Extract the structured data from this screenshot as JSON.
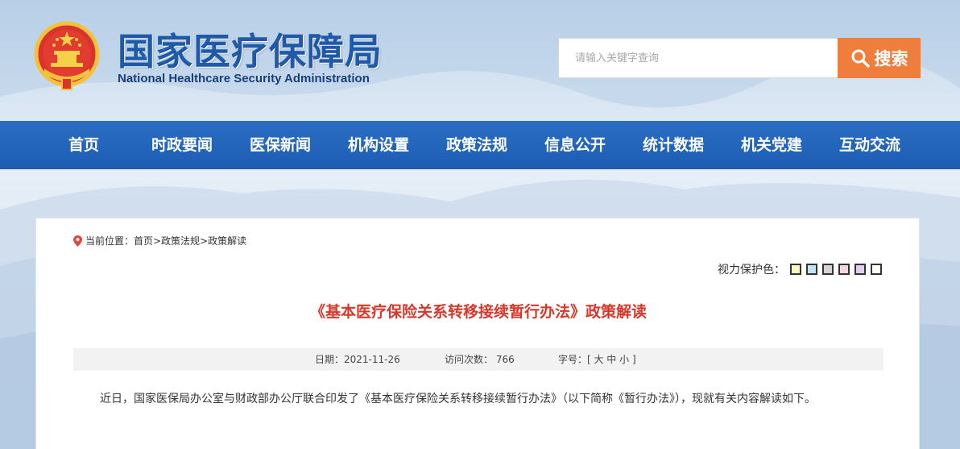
{
  "header": {
    "title": "国家医疗保障局",
    "subtitle": "National Healthcare Security Administration",
    "logo_icon": "national-emblem-icon"
  },
  "search": {
    "placeholder": "请输入关键字查询",
    "button_label": "搜索",
    "button_color": "#ef7d3c",
    "icon": "search-icon"
  },
  "nav": {
    "background": "#1d5db4",
    "items": [
      {
        "label": "首页"
      },
      {
        "label": "时政要闻"
      },
      {
        "label": "医保新闻"
      },
      {
        "label": "机构设置"
      },
      {
        "label": "政策法规"
      },
      {
        "label": "信息公开"
      },
      {
        "label": "统计数据"
      },
      {
        "label": "机关党建"
      },
      {
        "label": "互动交流"
      }
    ]
  },
  "breadcrumb": {
    "icon": "location-pin-icon",
    "text": "当前位置：首页>政策法规>政策解读"
  },
  "vision_protection": {
    "label": "视力保护色：",
    "swatches": [
      "#fafac0",
      "#bfe6f5",
      "#d5d5d5",
      "#f6d6dc",
      "#e2cdf3",
      "#ffffff"
    ]
  },
  "article": {
    "title": "《基本医疗保险关系转移接续暂行办法》政策解读",
    "title_color": "#d8382b",
    "date": "日期：2021-11-26",
    "visits": "访问次数： 766",
    "font_size": "字号：[ 大 中 小 ]",
    "body": "近日，国家医保局办公室与财政部办公厅联合印发了《基本医疗保险关系转移接续暂行办法》（以下简称《暂行办法》），现就有关内容解读如下。"
  }
}
